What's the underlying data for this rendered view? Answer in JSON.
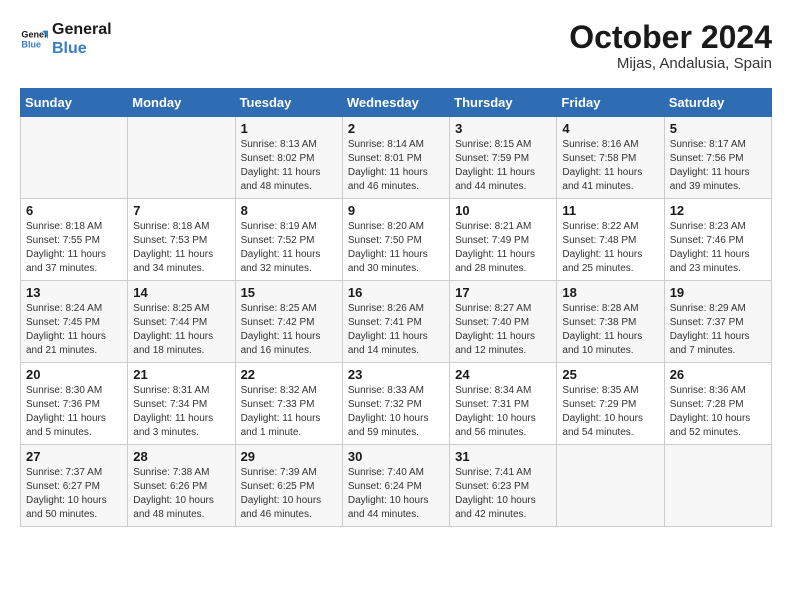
{
  "header": {
    "logo_line1": "General",
    "logo_line2": "Blue",
    "month_year": "October 2024",
    "location": "Mijas, Andalusia, Spain"
  },
  "days_of_week": [
    "Sunday",
    "Monday",
    "Tuesday",
    "Wednesday",
    "Thursday",
    "Friday",
    "Saturday"
  ],
  "weeks": [
    [
      {
        "num": "",
        "detail": ""
      },
      {
        "num": "",
        "detail": ""
      },
      {
        "num": "1",
        "detail": "Sunrise: 8:13 AM\nSunset: 8:02 PM\nDaylight: 11 hours and 48 minutes."
      },
      {
        "num": "2",
        "detail": "Sunrise: 8:14 AM\nSunset: 8:01 PM\nDaylight: 11 hours and 46 minutes."
      },
      {
        "num": "3",
        "detail": "Sunrise: 8:15 AM\nSunset: 7:59 PM\nDaylight: 11 hours and 44 minutes."
      },
      {
        "num": "4",
        "detail": "Sunrise: 8:16 AM\nSunset: 7:58 PM\nDaylight: 11 hours and 41 minutes."
      },
      {
        "num": "5",
        "detail": "Sunrise: 8:17 AM\nSunset: 7:56 PM\nDaylight: 11 hours and 39 minutes."
      }
    ],
    [
      {
        "num": "6",
        "detail": "Sunrise: 8:18 AM\nSunset: 7:55 PM\nDaylight: 11 hours and 37 minutes."
      },
      {
        "num": "7",
        "detail": "Sunrise: 8:18 AM\nSunset: 7:53 PM\nDaylight: 11 hours and 34 minutes."
      },
      {
        "num": "8",
        "detail": "Sunrise: 8:19 AM\nSunset: 7:52 PM\nDaylight: 11 hours and 32 minutes."
      },
      {
        "num": "9",
        "detail": "Sunrise: 8:20 AM\nSunset: 7:50 PM\nDaylight: 11 hours and 30 minutes."
      },
      {
        "num": "10",
        "detail": "Sunrise: 8:21 AM\nSunset: 7:49 PM\nDaylight: 11 hours and 28 minutes."
      },
      {
        "num": "11",
        "detail": "Sunrise: 8:22 AM\nSunset: 7:48 PM\nDaylight: 11 hours and 25 minutes."
      },
      {
        "num": "12",
        "detail": "Sunrise: 8:23 AM\nSunset: 7:46 PM\nDaylight: 11 hours and 23 minutes."
      }
    ],
    [
      {
        "num": "13",
        "detail": "Sunrise: 8:24 AM\nSunset: 7:45 PM\nDaylight: 11 hours and 21 minutes."
      },
      {
        "num": "14",
        "detail": "Sunrise: 8:25 AM\nSunset: 7:44 PM\nDaylight: 11 hours and 18 minutes."
      },
      {
        "num": "15",
        "detail": "Sunrise: 8:25 AM\nSunset: 7:42 PM\nDaylight: 11 hours and 16 minutes."
      },
      {
        "num": "16",
        "detail": "Sunrise: 8:26 AM\nSunset: 7:41 PM\nDaylight: 11 hours and 14 minutes."
      },
      {
        "num": "17",
        "detail": "Sunrise: 8:27 AM\nSunset: 7:40 PM\nDaylight: 11 hours and 12 minutes."
      },
      {
        "num": "18",
        "detail": "Sunrise: 8:28 AM\nSunset: 7:38 PM\nDaylight: 11 hours and 10 minutes."
      },
      {
        "num": "19",
        "detail": "Sunrise: 8:29 AM\nSunset: 7:37 PM\nDaylight: 11 hours and 7 minutes."
      }
    ],
    [
      {
        "num": "20",
        "detail": "Sunrise: 8:30 AM\nSunset: 7:36 PM\nDaylight: 11 hours and 5 minutes."
      },
      {
        "num": "21",
        "detail": "Sunrise: 8:31 AM\nSunset: 7:34 PM\nDaylight: 11 hours and 3 minutes."
      },
      {
        "num": "22",
        "detail": "Sunrise: 8:32 AM\nSunset: 7:33 PM\nDaylight: 11 hours and 1 minute."
      },
      {
        "num": "23",
        "detail": "Sunrise: 8:33 AM\nSunset: 7:32 PM\nDaylight: 10 hours and 59 minutes."
      },
      {
        "num": "24",
        "detail": "Sunrise: 8:34 AM\nSunset: 7:31 PM\nDaylight: 10 hours and 56 minutes."
      },
      {
        "num": "25",
        "detail": "Sunrise: 8:35 AM\nSunset: 7:29 PM\nDaylight: 10 hours and 54 minutes."
      },
      {
        "num": "26",
        "detail": "Sunrise: 8:36 AM\nSunset: 7:28 PM\nDaylight: 10 hours and 52 minutes."
      }
    ],
    [
      {
        "num": "27",
        "detail": "Sunrise: 7:37 AM\nSunset: 6:27 PM\nDaylight: 10 hours and 50 minutes."
      },
      {
        "num": "28",
        "detail": "Sunrise: 7:38 AM\nSunset: 6:26 PM\nDaylight: 10 hours and 48 minutes."
      },
      {
        "num": "29",
        "detail": "Sunrise: 7:39 AM\nSunset: 6:25 PM\nDaylight: 10 hours and 46 minutes."
      },
      {
        "num": "30",
        "detail": "Sunrise: 7:40 AM\nSunset: 6:24 PM\nDaylight: 10 hours and 44 minutes."
      },
      {
        "num": "31",
        "detail": "Sunrise: 7:41 AM\nSunset: 6:23 PM\nDaylight: 10 hours and 42 minutes."
      },
      {
        "num": "",
        "detail": ""
      },
      {
        "num": "",
        "detail": ""
      }
    ]
  ]
}
